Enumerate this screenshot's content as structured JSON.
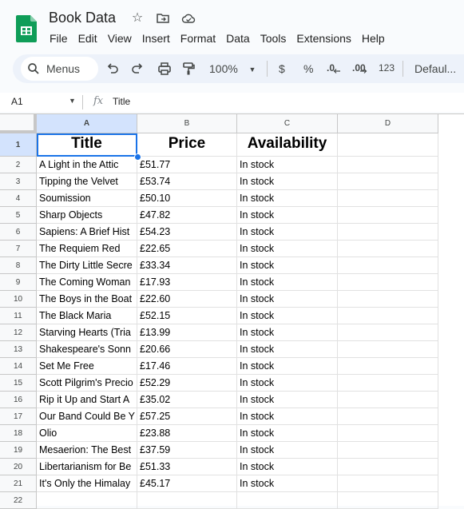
{
  "app": {
    "doc_title": "Book Data",
    "menus": [
      "File",
      "Edit",
      "View",
      "Insert",
      "Format",
      "Data",
      "Tools",
      "Extensions",
      "Help"
    ]
  },
  "toolbar": {
    "search_label": "Menus",
    "zoom": "100%",
    "currency": "$",
    "percent": "%",
    "dec_decrease": ".0",
    "dec_increase": ".00",
    "number_format": "123",
    "font": "Defaul..."
  },
  "formula_bar": {
    "cell_ref": "A1",
    "fx": "fx",
    "content": "Title"
  },
  "grid": {
    "columns": [
      "A",
      "B",
      "C",
      "D"
    ],
    "header_row": [
      "Title",
      "Price",
      "Availability"
    ],
    "rows": [
      [
        "A Light in the Attic",
        "£51.77",
        "In stock"
      ],
      [
        "Tipping the Velvet",
        "£53.74",
        "In stock"
      ],
      [
        "Soumission",
        "£50.10",
        "In stock"
      ],
      [
        "Sharp Objects",
        "£47.82",
        "In stock"
      ],
      [
        "Sapiens: A Brief Hist",
        "£54.23",
        "In stock"
      ],
      [
        "The Requiem Red",
        "£22.65",
        "In stock"
      ],
      [
        "The Dirty Little Secre",
        "£33.34",
        "In stock"
      ],
      [
        "The Coming Woman",
        "£17.93",
        "In stock"
      ],
      [
        "The Boys in the Boat",
        "£22.60",
        "In stock"
      ],
      [
        "The Black Maria",
        "£52.15",
        "In stock"
      ],
      [
        "Starving Hearts (Tria",
        "£13.99",
        "In stock"
      ],
      [
        "Shakespeare's Sonn",
        "£20.66",
        "In stock"
      ],
      [
        "Set Me Free",
        "£17.46",
        "In stock"
      ],
      [
        "Scott Pilgrim's Precio",
        "£52.29",
        "In stock"
      ],
      [
        "Rip it Up and Start A",
        "£35.02",
        "In stock"
      ],
      [
        "Our Band Could Be Y",
        "£57.25",
        "In stock"
      ],
      [
        "Olio",
        "£23.88",
        "In stock"
      ],
      [
        "Mesaerion: The Best",
        "£37.59",
        "In stock"
      ],
      [
        "Libertarianism for Be",
        "£51.33",
        "In stock"
      ],
      [
        "It's Only the Himalay",
        "£45.17",
        "In stock"
      ]
    ],
    "row_numbers": [
      "1",
      "2",
      "3",
      "4",
      "5",
      "6",
      "7",
      "8",
      "9",
      "10",
      "11",
      "12",
      "13",
      "14",
      "15",
      "16",
      "17",
      "18",
      "19",
      "20",
      "21",
      "22"
    ]
  },
  "colors": {
    "brand": "#0f9d58",
    "selection": "#1a73e8",
    "selected_header_bg": "#d3e3fd"
  }
}
